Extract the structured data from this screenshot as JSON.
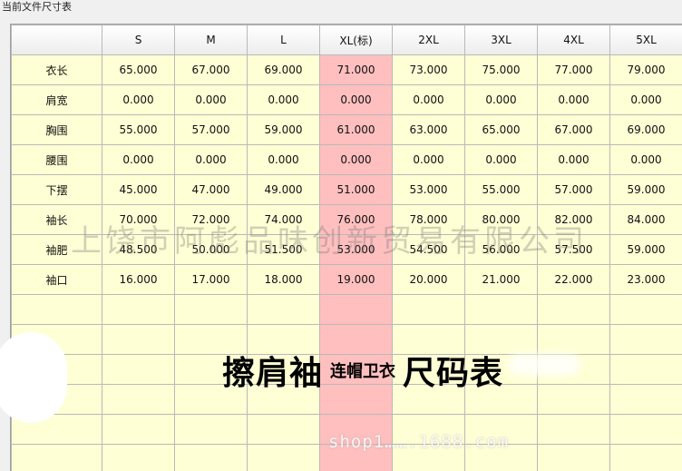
{
  "window": {
    "title": "当前文件尺寸表"
  },
  "table": {
    "columns": [
      "",
      "S",
      "M",
      "L",
      "XL(标)",
      "2XL",
      "3XL",
      "4XL",
      "5XL"
    ],
    "rows": [
      {
        "label": "衣长",
        "values": [
          "65.000",
          "67.000",
          "69.000",
          "71.000",
          "73.000",
          "75.000",
          "77.000",
          "79.000"
        ]
      },
      {
        "label": "肩宽",
        "values": [
          "0.000",
          "0.000",
          "0.000",
          "0.000",
          "0.000",
          "0.000",
          "0.000",
          "0.000"
        ]
      },
      {
        "label": "胸围",
        "values": [
          "55.000",
          "57.000",
          "59.000",
          "61.000",
          "63.000",
          "65.000",
          "67.000",
          "69.000"
        ]
      },
      {
        "label": "腰围",
        "values": [
          "0.000",
          "0.000",
          "0.000",
          "0.000",
          "0.000",
          "0.000",
          "0.000",
          "0.000"
        ]
      },
      {
        "label": "下摆",
        "values": [
          "45.000",
          "47.000",
          "49.000",
          "51.000",
          "53.000",
          "55.000",
          "57.000",
          "59.000"
        ]
      },
      {
        "label": "袖长",
        "values": [
          "70.000",
          "72.000",
          "74.000",
          "76.000",
          "78.000",
          "80.000",
          "82.000",
          "84.000"
        ]
      },
      {
        "label": "袖肥",
        "values": [
          "48.500",
          "50.000",
          "51.500",
          "53.000",
          "54.500",
          "56.000",
          "57.500",
          "59.000"
        ]
      },
      {
        "label": "袖口",
        "values": [
          "16.000",
          "17.000",
          "18.000",
          "19.000",
          "20.000",
          "21.000",
          "22.000",
          "23.000"
        ]
      }
    ],
    "empty_rows": 6,
    "highlight_column": "XL(标)"
  },
  "overlay": {
    "part1": "擦肩袖",
    "part2": "连帽卫衣",
    "part3": "尺码表"
  },
  "watermark": {
    "company": "上饶市阿彪品味创新贸易有限公司",
    "url": "shop1…….1688.com"
  },
  "colors": {
    "cell_bg": "#ffffd5",
    "highlight_bg": "#ffbfbf",
    "grid": "#b9b9b9"
  }
}
